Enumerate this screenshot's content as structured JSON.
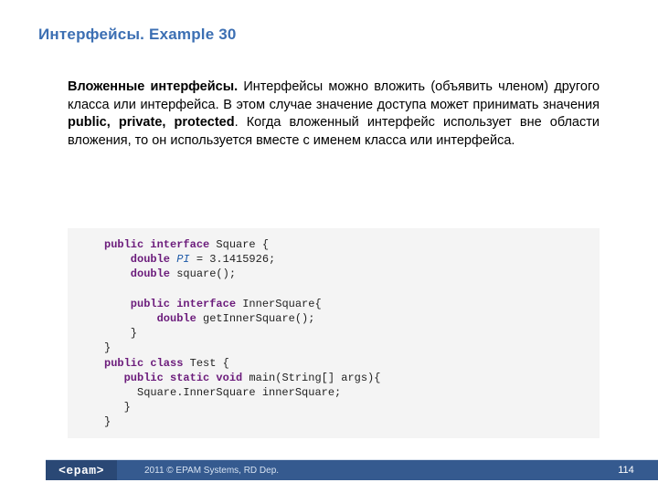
{
  "title": "Интерфейсы. Example 30",
  "paragraph": {
    "lead": "Вложенные интерфейсы.",
    "part1": " Интерфейсы можно вложить (объявить членом) другого класса или интерфейса. В этом случае значение доступа может принимать значения ",
    "mods": "public, private, protected",
    "part2": ". Когда вложенный интерфейс использует вне области вложения, то он используется вместе с именем класса или интерфейса."
  },
  "code": {
    "l1a": "public interface",
    "l1b": " Square {",
    "l2a": "    double",
    "l2b": " PI",
    "l2c": " = 3.1415926;",
    "l3a": "    double",
    "l3b": " square();",
    "l4": "",
    "l5a": "    public interface",
    "l5b": " InnerSquare{",
    "l6a": "        double",
    "l6b": " getInnerSquare();",
    "l7": "    }",
    "l8": "}",
    "l9a": "public class",
    "l9b": " Test {",
    "l10a": "   public static void",
    "l10b": " main(String[] args){",
    "l11": "     Square.InnerSquare innerSquare;",
    "l12": "   }",
    "l13": "}"
  },
  "footer": {
    "logo": "<epam>",
    "copyright": "2011 © EPAM Systems, RD Dep.",
    "page": "114"
  }
}
